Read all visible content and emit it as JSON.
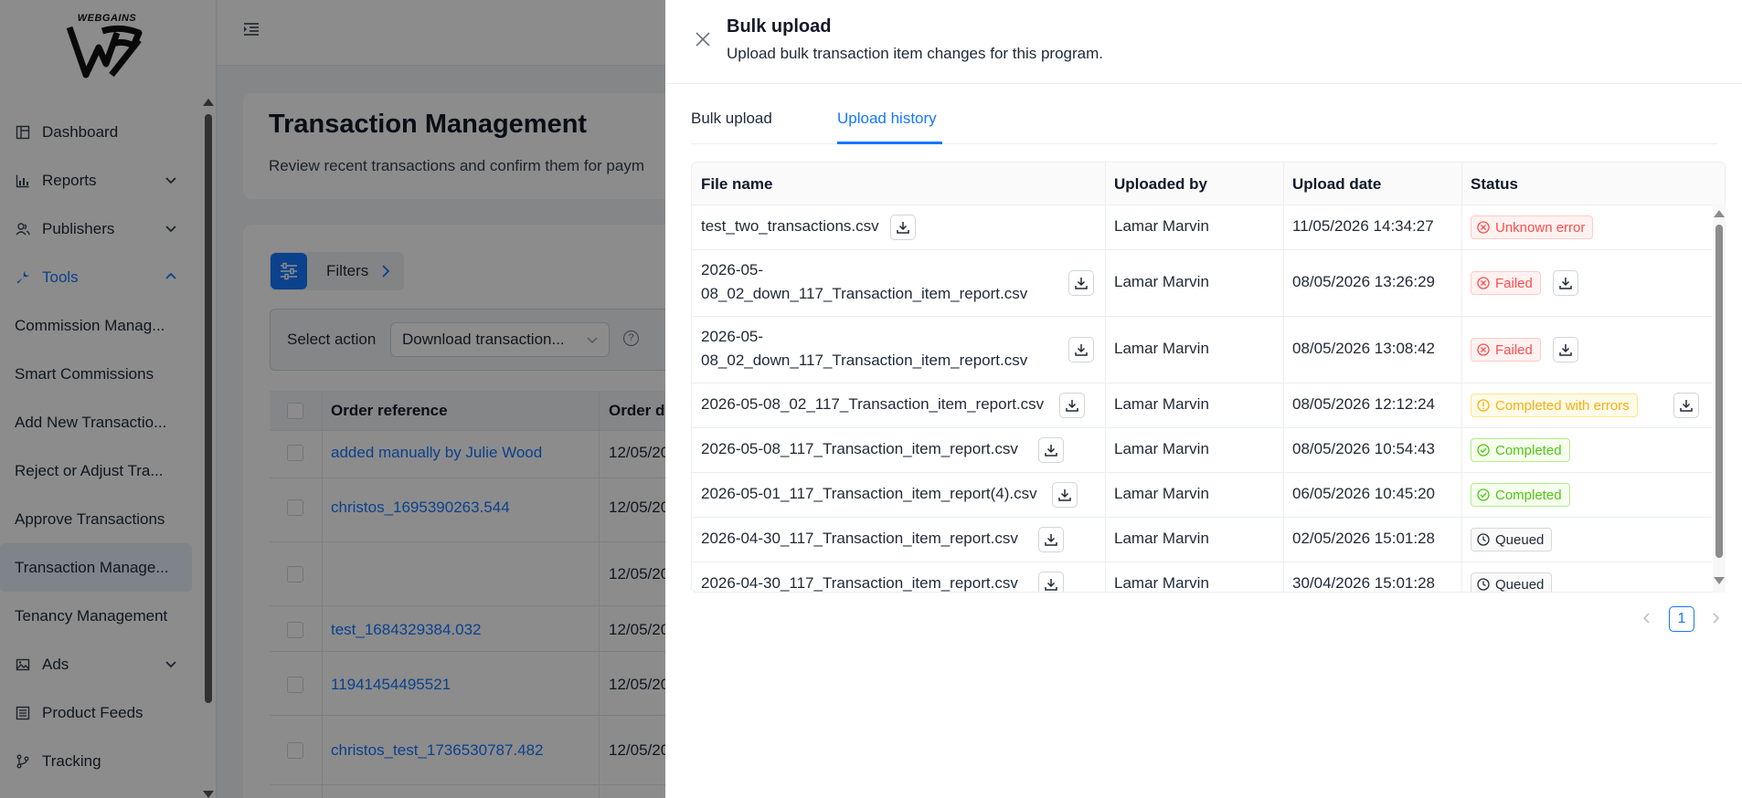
{
  "sidebar": {
    "logo_text": "WEBGAINS",
    "items": [
      {
        "label": "Dashboard",
        "icon": "dashboard-icon"
      },
      {
        "label": "Reports",
        "icon": "bar-chart-icon"
      },
      {
        "label": "Publishers",
        "icon": "users-icon"
      },
      {
        "label": "Tools",
        "icon": "wrench-icon"
      },
      {
        "label": "Ads",
        "icon": "image-icon"
      },
      {
        "label": "Product Feeds",
        "icon": "list-icon"
      },
      {
        "label": "Tracking",
        "icon": "branch-icon"
      }
    ],
    "sub_items": [
      "Commission Manag...",
      "Smart Commissions",
      "Add New Transactio...",
      "Reject or Adjust Tra...",
      "Approve Transactions",
      "Transaction Manage...",
      "Tenancy Management"
    ]
  },
  "main": {
    "title": "Transaction Management",
    "subtitle": "Review recent transactions and confirm them for paym",
    "filters_label": "Filters",
    "select_action_label": "Select action",
    "select_action_value": "Download transaction...",
    "columns": [
      "Order reference",
      "Order d"
    ],
    "rows": [
      {
        "ref": "added manually by Julie Wood",
        "date": "12/05/20"
      },
      {
        "ref": "christos_1695390263.544",
        "date": "12/05/20"
      },
      {
        "ref": "",
        "date": "12/05/20"
      },
      {
        "ref": "test_1684329384.032",
        "date": "12/05/20"
      },
      {
        "ref": "11941454495521",
        "date": "12/05/20"
      },
      {
        "ref": "christos_test_1736530787.482",
        "date": "12/05/20"
      }
    ]
  },
  "drawer": {
    "title": "Bulk upload",
    "subtitle": "Upload bulk transaction item changes for this program.",
    "tabs": [
      "Bulk upload",
      "Upload history"
    ],
    "active_tab": 1,
    "columns": [
      "File name",
      "Uploaded by",
      "Upload date",
      "Status"
    ],
    "rows": [
      {
        "file": "test_two_transactions.csv",
        "by": "Lamar Marvin",
        "date": "11/05/2026 14:34:27",
        "status": "Unknown error",
        "kind": "error",
        "status_download": false
      },
      {
        "file": "2026-05-08_02_down_117_Transaction_item_report.csv",
        "by": "Lamar Marvin",
        "date": "08/05/2026 13:26:29",
        "status": "Failed",
        "kind": "error",
        "status_download": true
      },
      {
        "file": "2026-05-08_02_down_117_Transaction_item_report.csv",
        "by": "Lamar Marvin",
        "date": "08/05/2026 13:08:42",
        "status": "Failed",
        "kind": "error",
        "status_download": true
      },
      {
        "file": "2026-05-08_02_117_Transaction_item_report.csv",
        "by": "Lamar Marvin",
        "date": "08/05/2026 12:12:24",
        "status": "Completed with errors",
        "kind": "warning",
        "status_download": true
      },
      {
        "file": "2026-05-08_117_Transaction_item_report.csv",
        "by": "Lamar Marvin",
        "date": "08/05/2026 10:54:43",
        "status": "Completed",
        "kind": "success",
        "status_download": false
      },
      {
        "file": "2026-05-01_117_Transaction_item_report(4).csv",
        "by": "Lamar Marvin",
        "date": "06/05/2026 10:45:20",
        "status": "Completed",
        "kind": "success",
        "status_download": false
      },
      {
        "file": "2026-04-30_117_Transaction_item_report.csv",
        "by": "Lamar Marvin",
        "date": "02/05/2026 15:01:28",
        "status": "Queued",
        "kind": "default",
        "status_download": false
      },
      {
        "file": "2026-04-30_117_Transaction_item_report.csv",
        "by": "Lamar Marvin",
        "date": "30/04/2026 15:01:28",
        "status": "Queued",
        "kind": "default",
        "status_download": false
      }
    ],
    "pagination": {
      "current": "1"
    }
  },
  "colors": {
    "accent": "#1677ff",
    "error": "#ff4d4f",
    "warning": "#faad14",
    "success": "#52c41a"
  }
}
